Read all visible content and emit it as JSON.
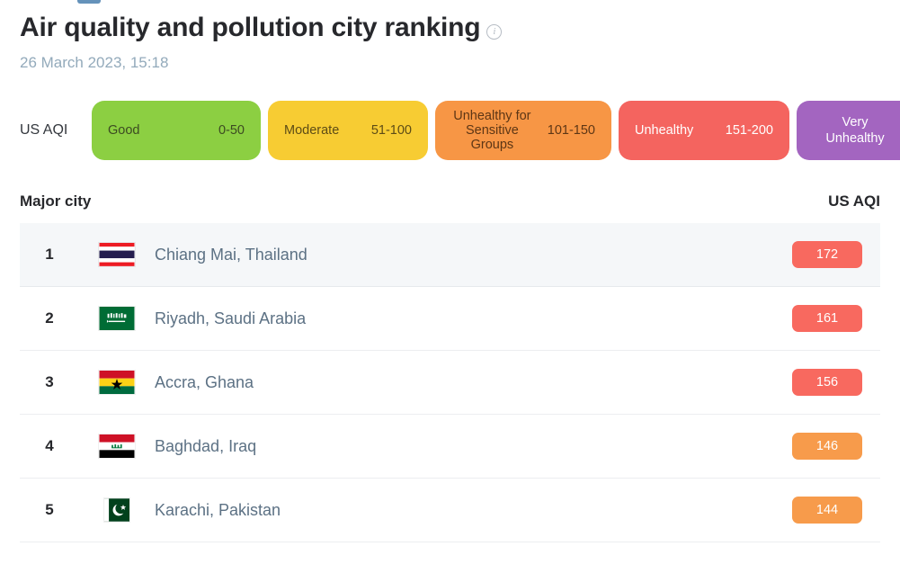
{
  "header": {
    "title": "Air quality and pollution city ranking",
    "info_icon": "info-circle-icon",
    "timestamp": "26 March 2023, 15:18"
  },
  "legend": {
    "label": "US AQI",
    "items": [
      {
        "name": "Good",
        "range": "0-50",
        "color": "#8ccf42",
        "text_color": "#3c4a22"
      },
      {
        "name": "Moderate",
        "range": "51-100",
        "color": "#f7cc33",
        "text_color": "#5d4c16"
      },
      {
        "name": "Unhealthy for Sensitive Groups",
        "range": "101-150",
        "color": "#f79645",
        "text_color": "#5d3615"
      },
      {
        "name": "Unhealthy",
        "range": "151-200",
        "color": "#f4645f",
        "text_color": "#ffffff"
      },
      {
        "name": "Very Unhealthy",
        "range": "",
        "color": "#a365c0",
        "text_color": "#ffffff"
      }
    ]
  },
  "table": {
    "columns": {
      "city": "Major city",
      "aqi": "US AQI"
    },
    "rows": [
      {
        "rank": "1",
        "city": "Chiang Mai, Thailand",
        "aqi": "172",
        "badge_color": "#f8695f",
        "flag": "flag-thailand"
      },
      {
        "rank": "2",
        "city": "Riyadh, Saudi Arabia",
        "aqi": "161",
        "badge_color": "#f8695f",
        "flag": "flag-saudi-arabia"
      },
      {
        "rank": "3",
        "city": "Accra, Ghana",
        "aqi": "156",
        "badge_color": "#f8695f",
        "flag": "flag-ghana"
      },
      {
        "rank": "4",
        "city": "Baghdad, Iraq",
        "aqi": "146",
        "badge_color": "#f79b4b",
        "flag": "flag-iraq"
      },
      {
        "rank": "5",
        "city": "Karachi, Pakistan",
        "aqi": "144",
        "badge_color": "#f79b4b",
        "flag": "flag-pakistan"
      }
    ]
  }
}
